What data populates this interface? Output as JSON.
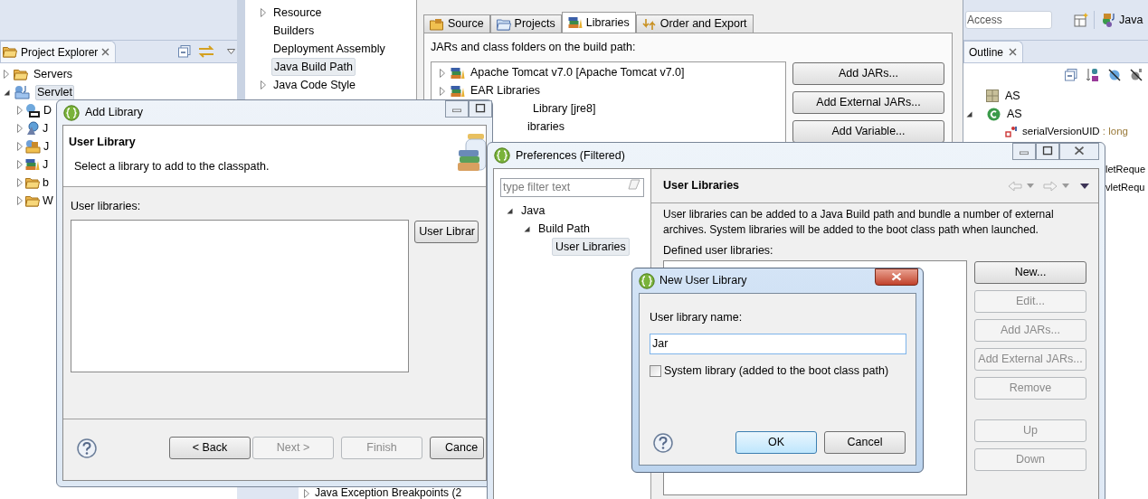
{
  "workbench": {
    "project_explorer": {
      "tab": "Project Explorer",
      "items": [
        {
          "label": "Servers",
          "kind": "folder",
          "expanded": false,
          "selected": false
        },
        {
          "label": "Servlet",
          "kind": "project",
          "expanded": true,
          "selected": true,
          "children": [
            {
              "label": "D",
              "kind": "descriptor",
              "expanded": false
            },
            {
              "label": "J",
              "kind": "globe",
              "expanded": false
            },
            {
              "label": "J",
              "kind": "package",
              "expanded": false
            },
            {
              "label": "J",
              "kind": "library",
              "expanded": false
            },
            {
              "label": "b",
              "kind": "folder",
              "expanded": false
            },
            {
              "label": "W",
              "kind": "folder",
              "expanded": false
            }
          ]
        }
      ]
    },
    "quick_access": {
      "placeholder": "Access"
    },
    "perspective": {
      "label": "Java"
    },
    "outline": {
      "tab": "Outline",
      "items": [
        {
          "label": "AS",
          "kind": "package"
        },
        {
          "label": "AS",
          "kind": "class",
          "expanded": true,
          "children": [
            {
              "label": "serialVersionUID",
              "type": " : long",
              "kind": "field"
            },
            {
              "label": "letReque",
              "kind": "partial"
            },
            {
              "label": "vletRequ",
              "kind": "partial"
            }
          ]
        }
      ]
    },
    "breakpoints": {
      "label": "Java Exception Breakpoints (2",
      "expanded": false
    }
  },
  "project_properties": {
    "tree": [
      {
        "label": "Resource",
        "expandable": true,
        "selected": false
      },
      {
        "label": "Builders",
        "expandable": false,
        "selected": false
      },
      {
        "label": "Deployment Assembly",
        "expandable": false,
        "selected": false
      },
      {
        "label": "Java Build Path",
        "expandable": false,
        "selected": true
      },
      {
        "label": "Java Code Style",
        "expandable": true,
        "selected": false
      }
    ],
    "tabs": [
      {
        "label": "Source",
        "kind": "source",
        "selected": false
      },
      {
        "label": "Projects",
        "kind": "projects",
        "selected": false
      },
      {
        "label": "Libraries",
        "kind": "libraries",
        "selected": true
      },
      {
        "label": "Order and Export",
        "kind": "order",
        "selected": false
      }
    ],
    "list_label": "JARs and class folders on the build path:",
    "entries": [
      {
        "label": "Apache Tomcat v7.0 [Apache Tomcat v7.0]",
        "kind": "library"
      },
      {
        "label": "EAR Libraries",
        "kind": "library"
      },
      {
        "label": "Library [jre8]",
        "kind": "partial"
      },
      {
        "label": "ibraries",
        "kind": "partial"
      }
    ],
    "buttons": [
      "Add JARs...",
      "Add External JARs...",
      "Add Variable..."
    ]
  },
  "add_library": {
    "title": "Add Library",
    "heading": "User Library",
    "description": "Select a library to add to the classpath.",
    "list_label": "User libraries:",
    "side_button": "User Librar",
    "buttons": [
      {
        "label": "< Back",
        "disabled": false
      },
      {
        "label": "Next >",
        "disabled": true
      },
      {
        "label": "Finish",
        "disabled": true
      },
      {
        "label": "Cance",
        "disabled": false
      }
    ]
  },
  "preferences": {
    "title": "Preferences (Filtered)",
    "filter": {
      "placeholder": "type filter text"
    },
    "tree": [
      {
        "label": "Java",
        "expanded": true,
        "selected": false,
        "children": [
          {
            "label": "Build Path",
            "expanded": true,
            "selected": false,
            "children": [
              {
                "label": "User Libraries",
                "selected": true
              }
            ]
          }
        ]
      }
    ],
    "page_title": "User Libraries",
    "description": "User libraries can be added to a Java Build path and bundle a number of external archives. System libraries will be added to the boot class path when launched.",
    "list_label": "Defined user libraries:",
    "buttons": [
      {
        "label": "New...",
        "disabled": false
      },
      {
        "label": "Edit...",
        "disabled": true
      },
      {
        "label": "Add JARs...",
        "disabled": true
      },
      {
        "label": "Add External JARs...",
        "disabled": true
      },
      {
        "label": "Remove",
        "disabled": true
      }
    ],
    "order_buttons": [
      {
        "label": "Up",
        "disabled": true
      },
      {
        "label": "Down",
        "disabled": true
      }
    ]
  },
  "new_user_library": {
    "title": "New User Library",
    "name_label": "User library name:",
    "name_value": "Jar",
    "system_library": {
      "label": "System library (added to the boot class path)",
      "checked": false
    },
    "buttons": [
      {
        "label": "OK",
        "default": true
      },
      {
        "label": "Cancel",
        "default": false
      }
    ]
  }
}
